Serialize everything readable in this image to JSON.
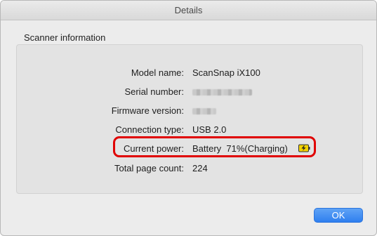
{
  "window": {
    "title": "Details"
  },
  "section": {
    "title": "Scanner information"
  },
  "info": {
    "model_label": "Model name:",
    "model_value": "ScanSnap iX100",
    "serial_label": "Serial number:",
    "serial_value": "",
    "firmware_label": "Firmware version:",
    "firmware_value": "",
    "connection_label": "Connection type:",
    "connection_value": "USB 2.0",
    "power_label": "Current power:",
    "power_value": "Battery  71%(Charging)",
    "pagecount_label": "Total page count:",
    "pagecount_value": "224"
  },
  "icons": {
    "battery": "battery-charging-icon"
  },
  "buttons": {
    "ok_label": "OK"
  },
  "colors": {
    "highlight": "#e00000",
    "button_accent": "#2f7fef"
  }
}
